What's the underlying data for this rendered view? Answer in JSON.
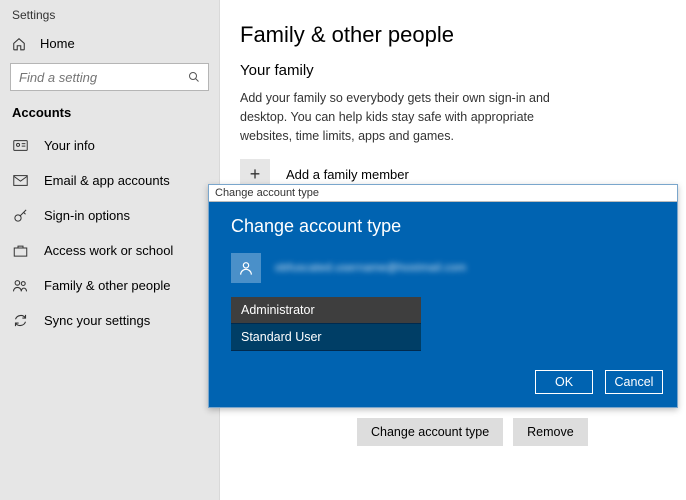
{
  "app_title": "Settings",
  "home_label": "Home",
  "search": {
    "placeholder": "Find a setting"
  },
  "section_heading": "Accounts",
  "nav": [
    {
      "label": "Your info"
    },
    {
      "label": "Email & app accounts"
    },
    {
      "label": "Sign-in options"
    },
    {
      "label": "Access work or school"
    },
    {
      "label": "Family & other people"
    },
    {
      "label": "Sync your settings"
    }
  ],
  "page": {
    "title": "Family & other people",
    "section_title": "Your family",
    "description": "Add your family so everybody gets their own sign-in and desktop. You can help kids stay safe with appropriate websites, time limits, apps and games.",
    "add_member_label": "Add a family member"
  },
  "action_buttons": {
    "change_type": "Change account type",
    "remove": "Remove"
  },
  "dialog": {
    "window_title": "Change account type",
    "heading": "Change account type",
    "email_masked": "obfuscated.username@hostmail.com",
    "types": {
      "administrator": "Administrator",
      "standard": "Standard User"
    },
    "ok": "OK",
    "cancel": "Cancel"
  }
}
